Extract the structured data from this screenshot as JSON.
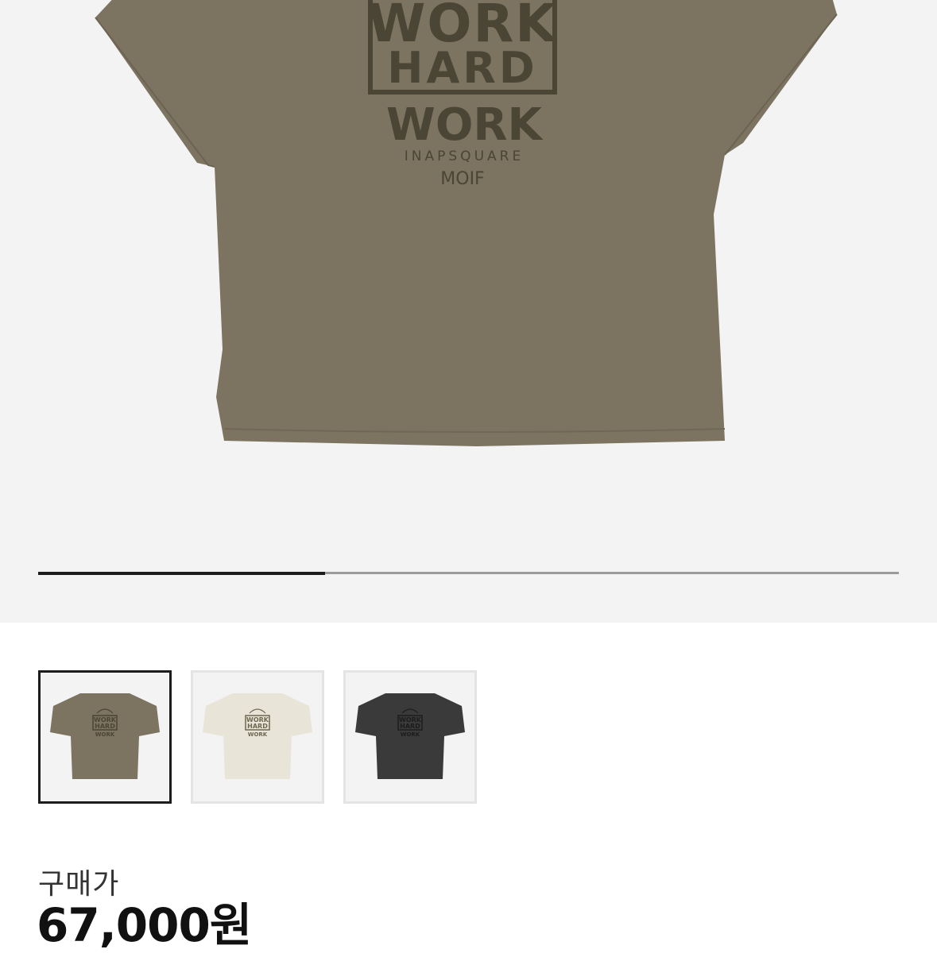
{
  "product": {
    "print_text": {
      "box_line1": "WORK",
      "box_line2": "HARD",
      "line3": "WORK",
      "line4": "INAPSQUARE",
      "line5": "MOIF"
    },
    "colors": {
      "olive": "#7c7360",
      "olive_ink": "#4b4536",
      "ivory": "#e8e4d8",
      "charcoal": "#3a3a3a"
    }
  },
  "gallery": {
    "progress_fraction": 0.333,
    "thumbnails": [
      {
        "name": "olive",
        "selected": true
      },
      {
        "name": "ivory",
        "selected": false
      },
      {
        "name": "charcoal",
        "selected": false
      }
    ]
  },
  "price": {
    "label": "구매가",
    "value": "67,000원"
  }
}
